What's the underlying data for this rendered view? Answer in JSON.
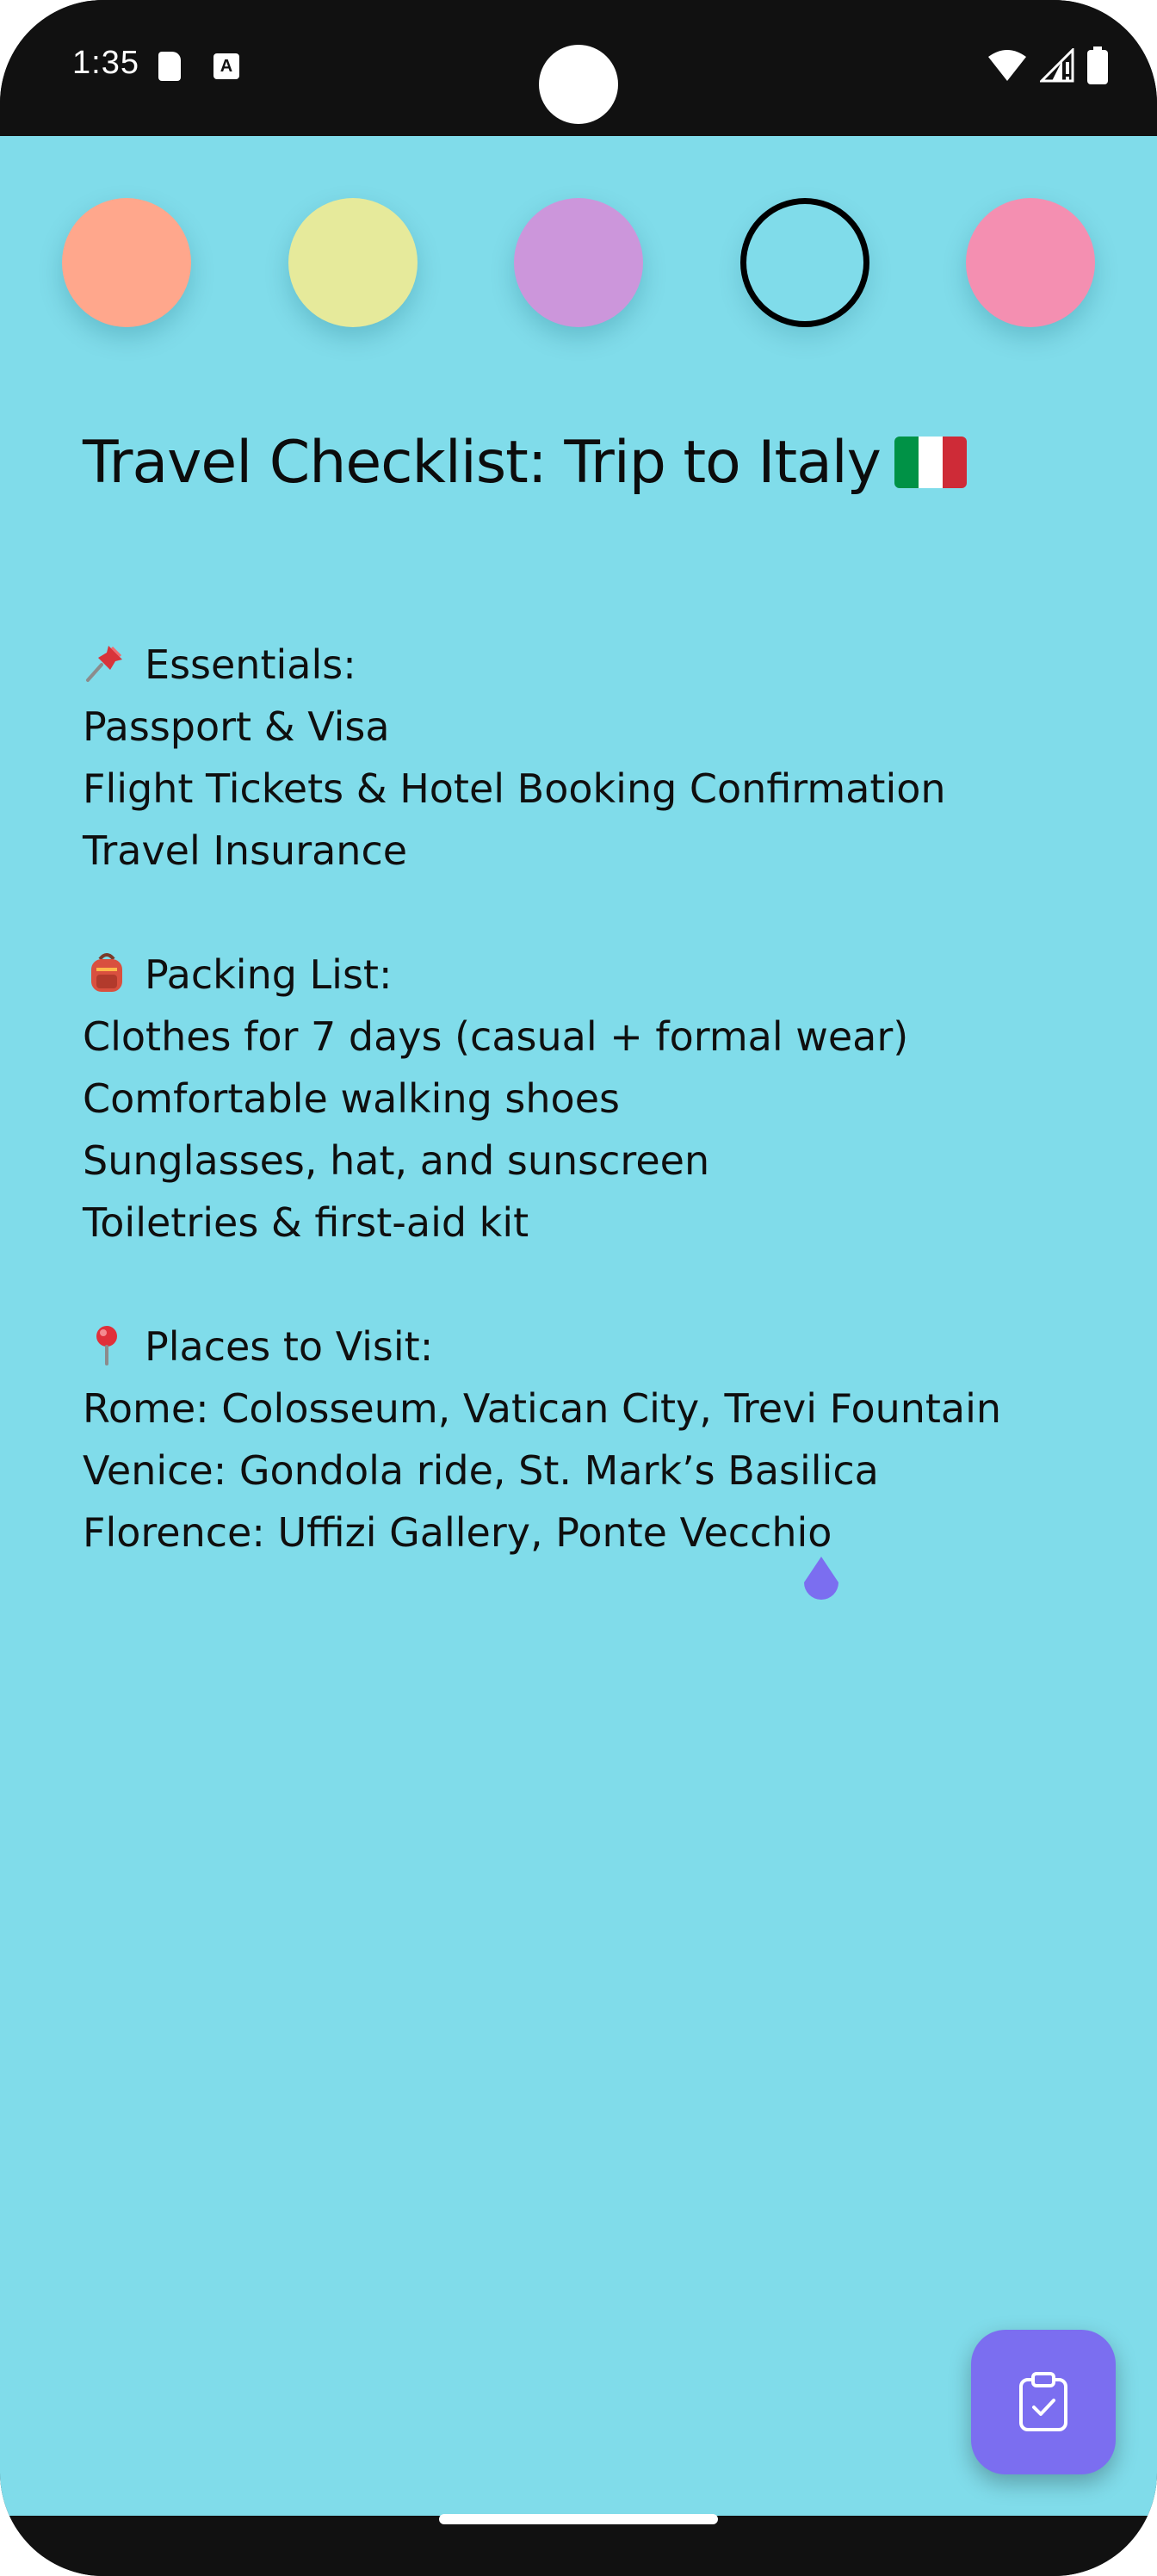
{
  "status_bar": {
    "time": "1:35",
    "a_icon_letter": "A",
    "icons": [
      "sd-card-icon",
      "a-notification-icon",
      "wifi-icon",
      "signal-icon",
      "battery-icon"
    ]
  },
  "color_swatches": [
    {
      "name": "peach",
      "color": "#ffa78c",
      "selected": false
    },
    {
      "name": "yellow",
      "color": "#e6ea9b",
      "selected": false
    },
    {
      "name": "purple",
      "color": "#cc96db",
      "selected": false
    },
    {
      "name": "cyan",
      "color": "#80dcea",
      "selected": true
    },
    {
      "name": "pink",
      "color": "#f48fb1",
      "selected": false
    }
  ],
  "note": {
    "title": "Travel Checklist: Trip to Italy",
    "background": "#80dcea",
    "sections": [
      {
        "heading": "Essentials:",
        "icon": "pushpin-icon",
        "items": [
          "Passport & Visa",
          "Flight Tickets & Hotel Booking Confirmation",
          "Travel Insurance"
        ]
      },
      {
        "heading": "Packing List:",
        "icon": "backpack-icon",
        "items": [
          "Clothes for 7 days (casual + formal wear)",
          "Comfortable walking shoes",
          "Sunglasses, hat, and sunscreen",
          "Toiletries & first-aid kit"
        ]
      },
      {
        "heading": "Places to Visit:",
        "icon": "round-pushpin-icon",
        "items": [
          "Rome: Colosseum, Vatican City, Trevi Fountain",
          "Venice: Gondola ride, St. Mark’s Basilica",
          "Florence: Uffizi Gallery, Ponte Vecchio"
        ]
      }
    ]
  },
  "fab": {
    "icon": "clipboard-check-icon",
    "color": "#7b6ef0"
  },
  "accent_colors": {
    "cursor_handle": "#7b6ef0",
    "flag_green": "#009246",
    "flag_white": "#ffffff",
    "flag_red": "#ce2b37"
  }
}
